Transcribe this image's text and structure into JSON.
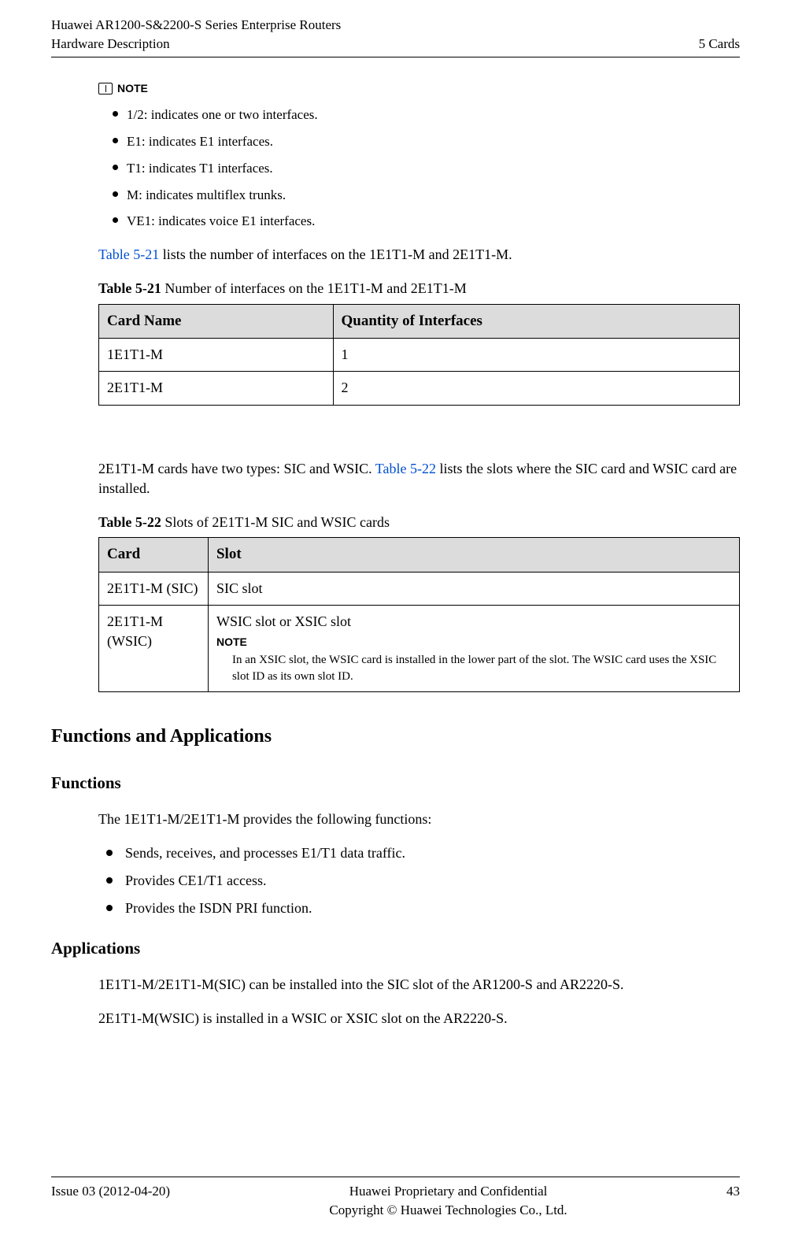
{
  "header": {
    "title_line1": "Huawei AR1200-S&2200-S Series Enterprise Routers",
    "title_line2": "Hardware Description",
    "right": "5 Cards"
  },
  "note": {
    "label": "NOTE",
    "items": [
      "1/2: indicates one or two interfaces.",
      "E1: indicates E1 interfaces.",
      "T1: indicates T1 interfaces.",
      "M: indicates multiflex trunks.",
      "VE1: indicates voice E1 interfaces."
    ]
  },
  "para1_pre": "Table 5-21",
  "para1_post": " lists the number of interfaces on the 1E1T1-M and 2E1T1-M.",
  "table21": {
    "caption_b": "Table 5-21",
    "caption_rest": " Number of interfaces on the 1E1T1-M and 2E1T1-M",
    "h1": "Card Name",
    "h2": "Quantity of Interfaces",
    "rows": [
      {
        "c1": "1E1T1-M",
        "c2": "1"
      },
      {
        "c1": "2E1T1-M",
        "c2": "2"
      }
    ]
  },
  "para2_pre": "2E1T1-M cards have two types: SIC and WSIC. ",
  "para2_link": "Table 5-22",
  "para2_post": " lists the slots where the SIC card and WSIC card are installed.",
  "table22": {
    "caption_b": "Table 5-22",
    "caption_rest": " Slots of 2E1T1-M SIC and WSIC cards",
    "h1": "Card",
    "h2": "Slot",
    "rows": [
      {
        "c1": "2E1T1-M (SIC)",
        "c2": "SIC slot",
        "note_label": "",
        "note_text": ""
      },
      {
        "c1": "2E1T1-M (WSIC)",
        "c2": "WSIC slot or XSIC slot",
        "note_label": "NOTE",
        "note_text": "In an XSIC slot, the WSIC card is installed in the lower part of the slot. The WSIC card uses the XSIC slot ID as its own slot ID."
      }
    ]
  },
  "section_heading": "Functions and Applications",
  "functions": {
    "heading": "Functions",
    "intro": "The 1E1T1-M/2E1T1-M provides the following functions:",
    "items": [
      "Sends, receives, and processes E1/T1 data traffic.",
      "Provides CE1/T1 access.",
      "Provides the ISDN PRI function."
    ]
  },
  "applications": {
    "heading": "Applications",
    "p1": "1E1T1-M/2E1T1-M(SIC) can be installed into the SIC slot of the AR1200-S and AR2220-S.",
    "p2": "2E1T1-M(WSIC) is installed in a WSIC or XSIC slot on the AR2220-S."
  },
  "footer": {
    "left": "Issue 03 (2012-04-20)",
    "center_l1": "Huawei Proprietary and Confidential",
    "center_l2": "Copyright © Huawei Technologies Co., Ltd.",
    "right": "43"
  }
}
